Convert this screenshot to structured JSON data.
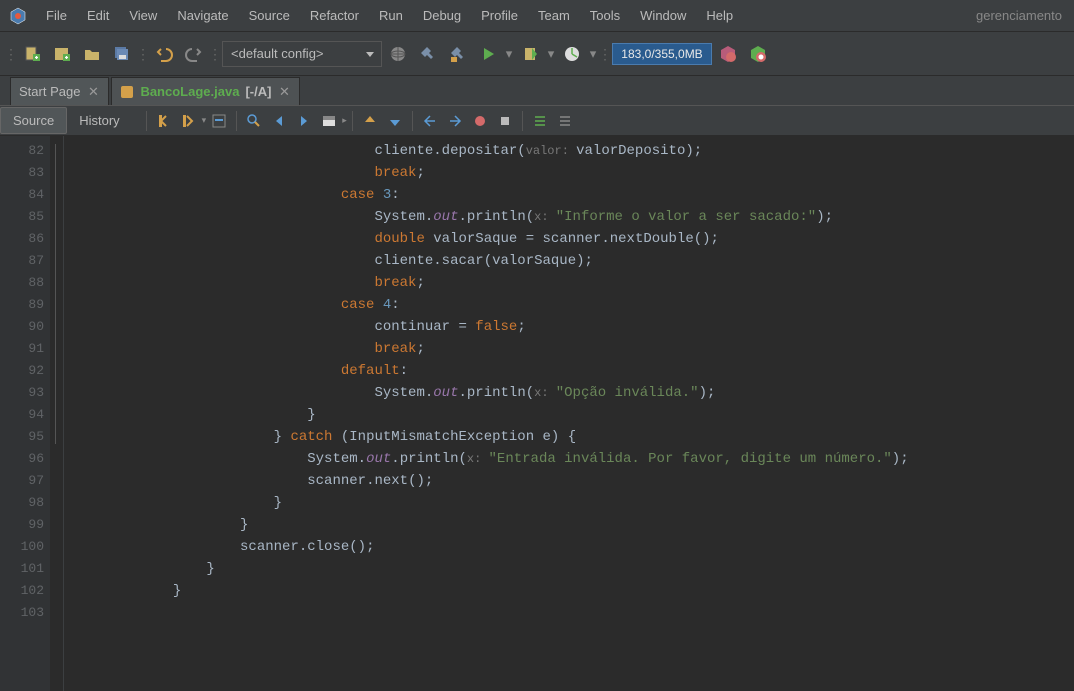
{
  "menubar": {
    "items": [
      "File",
      "Edit",
      "View",
      "Navigate",
      "Source",
      "Refactor",
      "Run",
      "Debug",
      "Profile",
      "Team",
      "Tools",
      "Window",
      "Help"
    ],
    "project": "gerenciamento"
  },
  "toolbar": {
    "config_selected": "<default config>",
    "memory": "183,0/355,0MB"
  },
  "tabs": [
    {
      "label": "Start Page",
      "modified": false,
      "suffix": ""
    },
    {
      "label": "BancoLage.java",
      "modified": true,
      "suffix": "[-/A]"
    }
  ],
  "editor_bar": {
    "modes": [
      "Source",
      "History"
    ]
  },
  "code": {
    "first_line": 82,
    "lines": [
      {
        "n": 82,
        "tok": [
          [
            "sp",
            "                                    "
          ],
          [
            "ident",
            "cliente"
          ],
          [
            "punct",
            "."
          ],
          [
            "method",
            "depositar"
          ],
          [
            "punct",
            "("
          ],
          [
            "hint",
            "valor: "
          ],
          [
            "ident",
            "valorDeposito"
          ],
          [
            "punct",
            ");"
          ]
        ]
      },
      {
        "n": 83,
        "tok": [
          [
            "sp",
            "                                    "
          ],
          [
            "kw",
            "break"
          ],
          [
            "punct",
            ";"
          ]
        ]
      },
      {
        "n": 84,
        "tok": [
          [
            "sp",
            "                                "
          ],
          [
            "kw",
            "case"
          ],
          [
            "sp",
            " "
          ],
          [
            "num",
            "3"
          ],
          [
            "punct",
            ":"
          ]
        ]
      },
      {
        "n": 85,
        "tok": [
          [
            "sp",
            "                                    "
          ],
          [
            "ident",
            "System"
          ],
          [
            "punct",
            "."
          ],
          [
            "field",
            "out"
          ],
          [
            "punct",
            "."
          ],
          [
            "method",
            "println"
          ],
          [
            "punct",
            "("
          ],
          [
            "hint",
            "x: "
          ],
          [
            "str",
            "\"Informe o valor a ser sacado:\""
          ],
          [
            "punct",
            ");"
          ]
        ]
      },
      {
        "n": 86,
        "tok": [
          [
            "sp",
            "                                    "
          ],
          [
            "kw",
            "double"
          ],
          [
            "sp",
            " "
          ],
          [
            "ident",
            "valorSaque"
          ],
          [
            "sp",
            " "
          ],
          [
            "punct",
            "="
          ],
          [
            "sp",
            " "
          ],
          [
            "ident",
            "scanner"
          ],
          [
            "punct",
            "."
          ],
          [
            "method",
            "nextDouble"
          ],
          [
            "punct",
            "();"
          ]
        ]
      },
      {
        "n": 87,
        "tok": [
          [
            "sp",
            "                                    "
          ],
          [
            "ident",
            "cliente"
          ],
          [
            "punct",
            "."
          ],
          [
            "method",
            "sacar"
          ],
          [
            "punct",
            "("
          ],
          [
            "ident",
            "valorSaque"
          ],
          [
            "punct",
            ");"
          ]
        ]
      },
      {
        "n": 88,
        "tok": [
          [
            "sp",
            "                                    "
          ],
          [
            "kw",
            "break"
          ],
          [
            "punct",
            ";"
          ]
        ]
      },
      {
        "n": 89,
        "tok": [
          [
            "sp",
            "                                "
          ],
          [
            "kw",
            "case"
          ],
          [
            "sp",
            " "
          ],
          [
            "num",
            "4"
          ],
          [
            "punct",
            ":"
          ]
        ]
      },
      {
        "n": 90,
        "tok": [
          [
            "sp",
            "                                    "
          ],
          [
            "ident",
            "continuar"
          ],
          [
            "sp",
            " "
          ],
          [
            "punct",
            "="
          ],
          [
            "sp",
            " "
          ],
          [
            "kw",
            "false"
          ],
          [
            "punct",
            ";"
          ]
        ]
      },
      {
        "n": 91,
        "tok": [
          [
            "sp",
            "                                    "
          ],
          [
            "kw",
            "break"
          ],
          [
            "punct",
            ";"
          ]
        ]
      },
      {
        "n": 92,
        "tok": [
          [
            "sp",
            "                                "
          ],
          [
            "kw",
            "default"
          ],
          [
            "punct",
            ":"
          ]
        ]
      },
      {
        "n": 93,
        "tok": [
          [
            "sp",
            "                                    "
          ],
          [
            "ident",
            "System"
          ],
          [
            "punct",
            "."
          ],
          [
            "field",
            "out"
          ],
          [
            "punct",
            "."
          ],
          [
            "method",
            "println"
          ],
          [
            "punct",
            "("
          ],
          [
            "hint",
            "x: "
          ],
          [
            "str",
            "\"Opção inválida.\""
          ],
          [
            "punct",
            ");"
          ]
        ]
      },
      {
        "n": 94,
        "tok": [
          [
            "sp",
            "                            "
          ],
          [
            "punct",
            "}"
          ]
        ]
      },
      {
        "n": 95,
        "tok": [
          [
            "sp",
            "                        "
          ],
          [
            "punct",
            "}"
          ],
          [
            "sp",
            " "
          ],
          [
            "kw",
            "catch"
          ],
          [
            "sp",
            " "
          ],
          [
            "punct",
            "("
          ],
          [
            "ident",
            "InputMismatchException e"
          ],
          [
            "punct",
            ")"
          ],
          [
            "sp",
            " "
          ],
          [
            "punct",
            "{"
          ]
        ]
      },
      {
        "n": 96,
        "tok": [
          [
            "sp",
            "                            "
          ],
          [
            "ident",
            "System"
          ],
          [
            "punct",
            "."
          ],
          [
            "field",
            "out"
          ],
          [
            "punct",
            "."
          ],
          [
            "method",
            "println"
          ],
          [
            "punct",
            "("
          ],
          [
            "hint",
            "x: "
          ],
          [
            "str",
            "\"Entrada inválida. Por favor, digite um número.\""
          ],
          [
            "punct",
            ");"
          ]
        ]
      },
      {
        "n": 97,
        "tok": [
          [
            "sp",
            "                            "
          ],
          [
            "ident",
            "scanner"
          ],
          [
            "punct",
            "."
          ],
          [
            "method",
            "next"
          ],
          [
            "punct",
            "();"
          ]
        ]
      },
      {
        "n": 98,
        "tok": [
          [
            "sp",
            "                        "
          ],
          [
            "punct",
            "}"
          ]
        ]
      },
      {
        "n": 99,
        "tok": [
          [
            "sp",
            "                    "
          ],
          [
            "punct",
            "}"
          ]
        ]
      },
      {
        "n": 100,
        "tok": [
          [
            "sp",
            "                    "
          ],
          [
            "ident",
            "scanner"
          ],
          [
            "punct",
            "."
          ],
          [
            "method",
            "close"
          ],
          [
            "punct",
            "();"
          ]
        ]
      },
      {
        "n": 101,
        "tok": [
          [
            "sp",
            "                "
          ],
          [
            "punct",
            "}"
          ]
        ]
      },
      {
        "n": 102,
        "tok": [
          [
            "sp",
            "            "
          ],
          [
            "punct",
            "}"
          ]
        ]
      },
      {
        "n": 103,
        "tok": []
      }
    ]
  }
}
